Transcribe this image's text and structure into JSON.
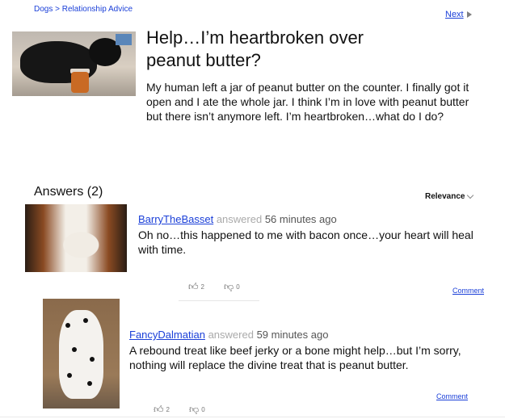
{
  "breadcrumb": "Dogs > Relationship Advice",
  "next_label": "Next",
  "question": {
    "title": "Help…I’m heartbroken over peanut butter?",
    "body": "My human left a jar of peanut butter on the counter. I finally got it open and I ate the whole jar. I think I’m in love with peanut butter but there isn’t anymore left. I’m heartbroken…what do I do?"
  },
  "answers_heading": "Answers (2)",
  "sort_label": "Relevance",
  "answers": [
    {
      "author": "BarryTheBasset",
      "verb": "answered",
      "time": "56 minutes ago",
      "text": "Oh no…this happened to me with bacon once…your heart will heal with time.",
      "upvotes": "2",
      "downvotes": "0",
      "comment_label": "Comment"
    },
    {
      "author": "FancyDalmatian",
      "verb": "answered",
      "time": "59 minutes ago",
      "text": "A rebound treat like beef jerky or a bone might help…but I’m sorry, nothing will replace the divine treat that is peanut butter.",
      "upvotes": "2",
      "downvotes": "0",
      "comment_label": "Comment"
    }
  ],
  "icons": {
    "upvote": "thumbs-up-icon",
    "downvote": "thumbs-down-icon",
    "next": "triangle-right-icon",
    "sort": "chevron-down-icon"
  },
  "colors": {
    "link": "#1a3fd8",
    "muted": "#aaaaaa"
  }
}
